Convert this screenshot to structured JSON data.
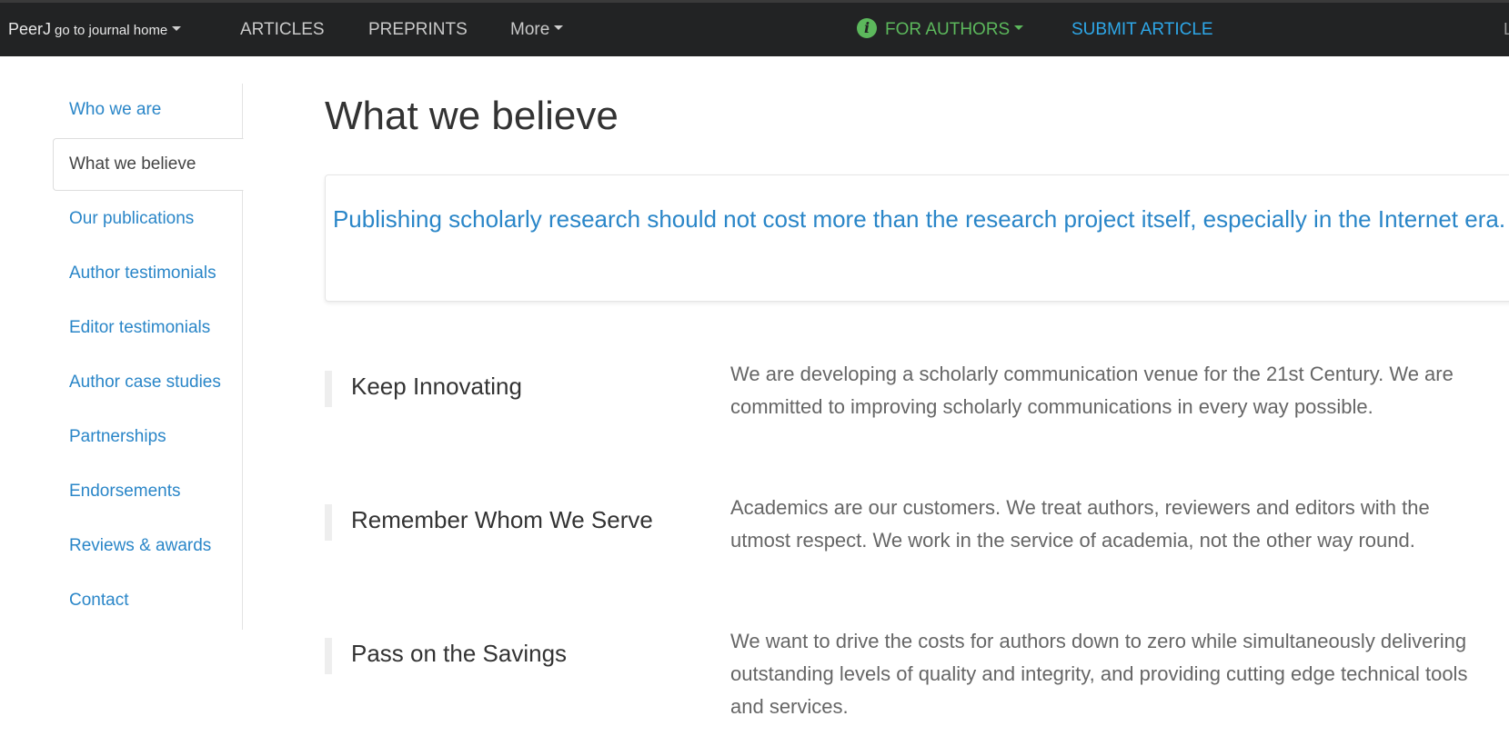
{
  "navbar": {
    "brand": "PeerJ",
    "brand_sub": "go to journal home",
    "articles": "ARTICLES",
    "preprints": "PREPRINTS",
    "more": "More",
    "for_authors": "FOR AUTHORS",
    "submit": "SUBMIT ARTICLE",
    "edge_text": "L",
    "info_icon": "i",
    "colors": {
      "background": "#222324",
      "for_authors": "#5cb85c",
      "submit": "#2ea7e8"
    }
  },
  "sidebar": {
    "items": [
      {
        "label": "Who we are"
      },
      {
        "label": "What we believe",
        "active": true
      },
      {
        "label": "Our publications"
      },
      {
        "label": "Author testimonials"
      },
      {
        "label": "Editor testimonials"
      },
      {
        "label": "Author case studies"
      },
      {
        "label": "Partnerships"
      },
      {
        "label": "Endorsements"
      },
      {
        "label": "Reviews & awards"
      },
      {
        "label": "Contact"
      }
    ]
  },
  "main": {
    "title": "What we believe",
    "quote": "Publishing scholarly research should not cost more than the research project itself, especially in the Internet era.",
    "beliefs": [
      {
        "heading": "Keep Innovating",
        "text": "We are developing a scholarly communication venue for the 21st Century. We are committed to improving scholarly communications in every way possible."
      },
      {
        "heading": "Remember Whom We Serve",
        "text": "Academics are our customers. We treat authors, reviewers and editors with the utmost respect. We work in the service of academia, not the other way round."
      },
      {
        "heading": "Pass on the Savings",
        "text": "We want to drive the costs for authors down to zero while simultaneously delivering outstanding levels of quality and integrity, and providing cutting edge technical tools and services."
      }
    ]
  },
  "colors": {
    "link": "#2a86c8",
    "text": "#333333",
    "muted": "#666666"
  }
}
